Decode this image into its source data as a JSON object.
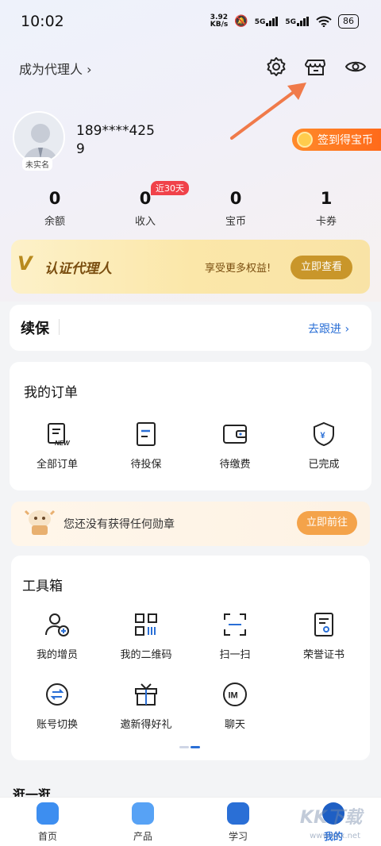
{
  "status_bar": {
    "time": "10:02",
    "net_speed": "3.92\nKB/s",
    "sim1": "5G",
    "sim2": "5G",
    "battery": "86"
  },
  "header": {
    "become_agent": "成为代理人 ›"
  },
  "profile": {
    "phone": "189****4259",
    "unverified_badge": "未实名",
    "signin_label": "签到得宝币"
  },
  "stats": {
    "items": [
      {
        "value": "0",
        "label": "余额"
      },
      {
        "value": "0",
        "label": "收入"
      },
      {
        "value": "0",
        "label": "宝币"
      },
      {
        "value": "1",
        "label": "卡券"
      }
    ],
    "income_tag": "近30天"
  },
  "vip": {
    "logo": "V",
    "title": "认证代理人",
    "subtitle": "享受更多权益!",
    "button": "立即查看"
  },
  "renew": {
    "title": "续保",
    "link": "去跟进 ›"
  },
  "orders": {
    "title": "我的订单",
    "items": [
      {
        "label": "全部订单",
        "icon": "clipboard-new-icon",
        "icon_text": "NEW"
      },
      {
        "label": "待投保",
        "icon": "document-icon"
      },
      {
        "label": "待缴费",
        "icon": "wallet-icon"
      },
      {
        "label": "已完成",
        "icon": "shield-yuan-icon",
        "icon_text": "¥"
      }
    ]
  },
  "medal": {
    "text": "您还没有获得任何勋章",
    "button": "立即前往"
  },
  "tools": {
    "title": "工具箱",
    "items": [
      {
        "label": "我的增员",
        "icon": "add-user-icon"
      },
      {
        "label": "我的二维码",
        "icon": "qrcode-icon"
      },
      {
        "label": "扫一扫",
        "icon": "scan-icon"
      },
      {
        "label": "荣誉证书",
        "icon": "certificate-icon"
      },
      {
        "label": "账号切换",
        "icon": "switch-icon"
      },
      {
        "label": "邀新得好礼",
        "icon": "gift-icon"
      },
      {
        "label": "聊天",
        "icon": "chat-icon",
        "icon_text": "IM"
      }
    ]
  },
  "browse": {
    "title": "逛一逛"
  },
  "tabbar": {
    "items": [
      {
        "label": "首页",
        "color": "#2a6fd6"
      },
      {
        "label": "产品",
        "color": "#3d8ef0"
      },
      {
        "label": "学习",
        "color": "#2a6fd6"
      },
      {
        "label": "我的",
        "color": "#2a6fd6"
      }
    ]
  },
  "watermark": {
    "text": "KK下载",
    "url": "www.kkx.net"
  },
  "colors": {
    "accent": "#2a6fd6",
    "orange": "#ff7a22",
    "gold": "#c9962a",
    "arrow": "#f07a4a"
  }
}
